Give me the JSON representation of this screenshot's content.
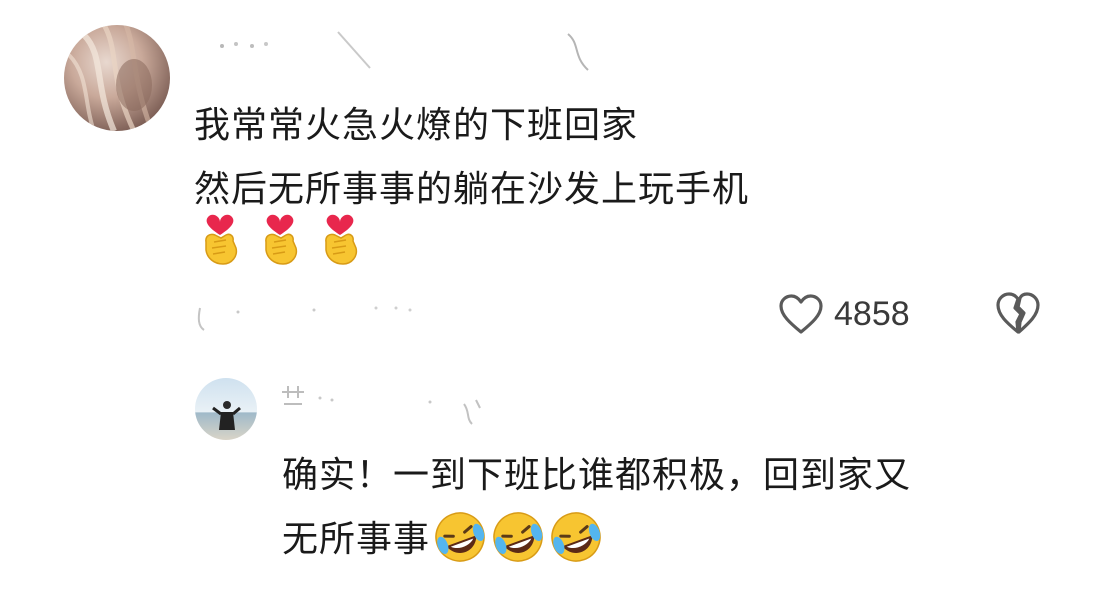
{
  "comment": {
    "lines": [
      "我常常火急火燎的下班回家",
      "然后无所事事的躺在沙发上玩手机"
    ],
    "emojis": [
      "finger-heart",
      "finger-heart",
      "finger-heart"
    ],
    "like_count": "4858",
    "icons": {
      "like": "heart-outline-icon",
      "dislike": "broken-heart-icon"
    }
  },
  "reply": {
    "lines": [
      "确实！一到下班比谁都积极，回到家又",
      "无所事事"
    ],
    "emojis": [
      "rolling-on-floor-laughing",
      "rolling-on-floor-laughing",
      "rolling-on-floor-laughing"
    ]
  },
  "colors": {
    "text": "#1a1a1a",
    "icon_gray": "#5a5a5a",
    "heart_red": "#e8274d",
    "emoji_yellow": "#f7c531"
  }
}
